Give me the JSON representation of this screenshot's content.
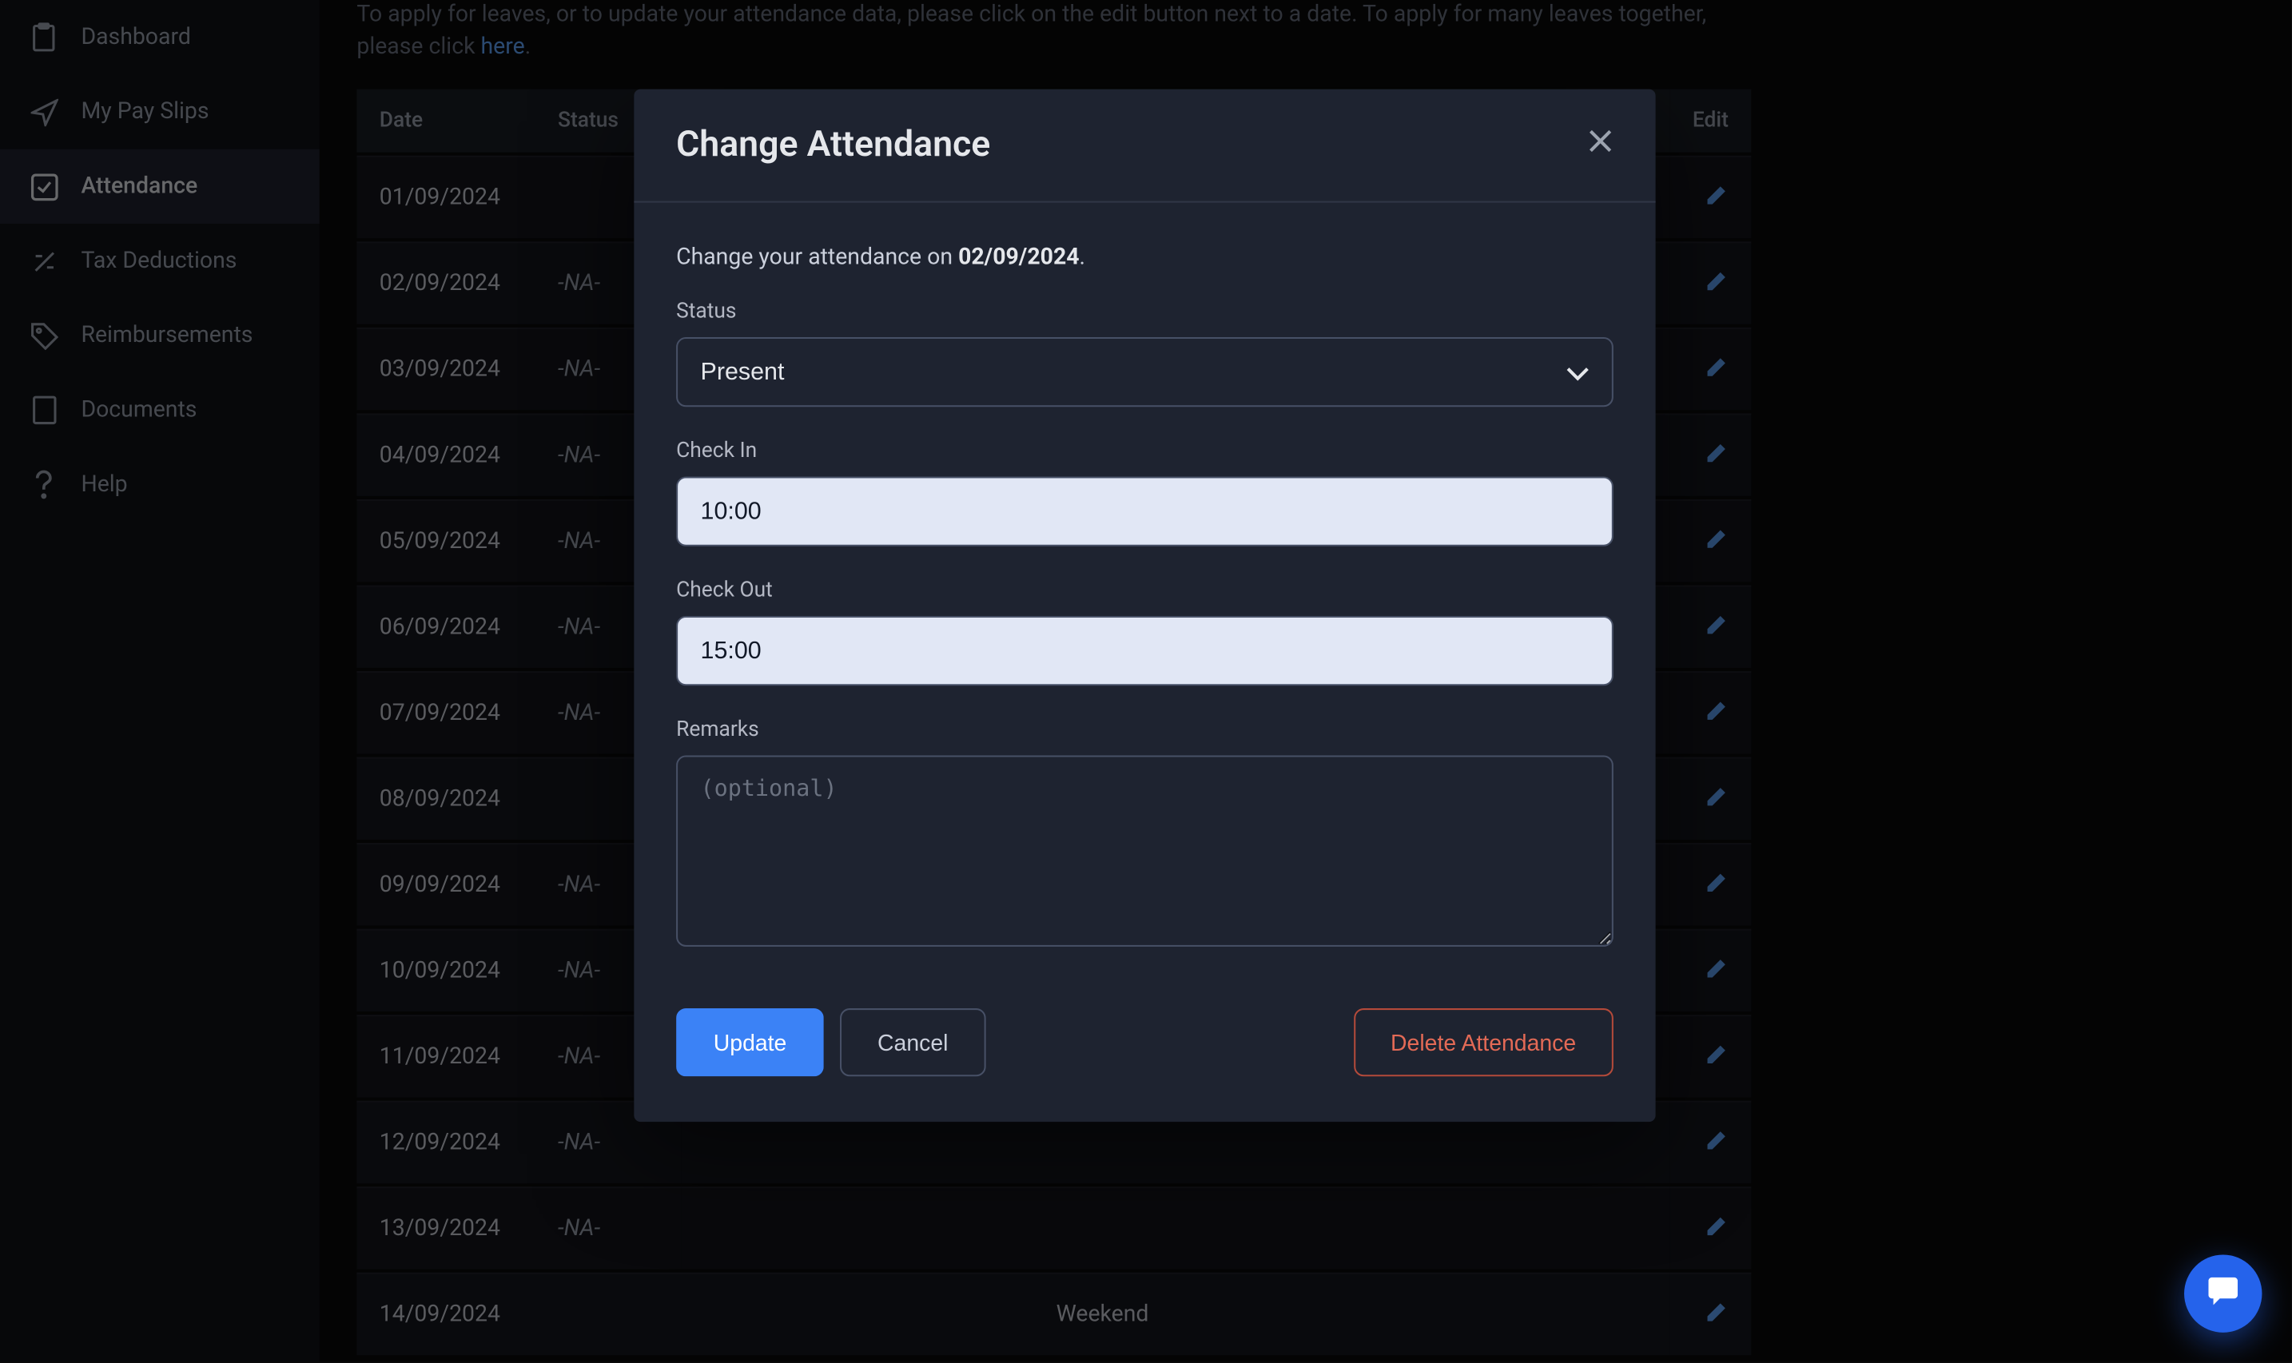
{
  "sidebar": {
    "items": [
      {
        "label": "Dashboard",
        "icon": "clipboard-icon",
        "active": false
      },
      {
        "label": "My Pay Slips",
        "icon": "send-icon",
        "active": false
      },
      {
        "label": "Attendance",
        "icon": "check-square-icon",
        "active": true
      },
      {
        "label": "Tax Deductions",
        "icon": "percent-icon",
        "active": false
      },
      {
        "label": "Reimbursements",
        "icon": "tag-icon",
        "active": false
      },
      {
        "label": "Documents",
        "icon": "document-icon",
        "active": false
      },
      {
        "label": "Help",
        "icon": "question-icon",
        "active": false
      }
    ]
  },
  "intro": {
    "text": "To apply for leaves, or to update your attendance data, please click on the edit button next to a date. To apply for many leaves together, please click ",
    "link_text": "here",
    "suffix": "."
  },
  "table": {
    "headers": {
      "date": "Date",
      "status": "Status",
      "edit": "Edit"
    },
    "rows": [
      {
        "date": "01/09/2024",
        "status": "",
        "weekend": false
      },
      {
        "date": "02/09/2024",
        "status": "-NA-",
        "weekend": false
      },
      {
        "date": "03/09/2024",
        "status": "-NA-",
        "weekend": false
      },
      {
        "date": "04/09/2024",
        "status": "-NA-",
        "weekend": false
      },
      {
        "date": "05/09/2024",
        "status": "-NA-",
        "weekend": false
      },
      {
        "date": "06/09/2024",
        "status": "-NA-",
        "weekend": false
      },
      {
        "date": "07/09/2024",
        "status": "-NA-",
        "weekend": false
      },
      {
        "date": "08/09/2024",
        "status": "",
        "weekend": false
      },
      {
        "date": "09/09/2024",
        "status": "-NA-",
        "weekend": false
      },
      {
        "date": "10/09/2024",
        "status": "-NA-",
        "weekend": false
      },
      {
        "date": "11/09/2024",
        "status": "-NA-",
        "weekend": false
      },
      {
        "date": "12/09/2024",
        "status": "-NA-",
        "weekend": false
      },
      {
        "date": "13/09/2024",
        "status": "-NA-",
        "weekend": false
      },
      {
        "date": "14/09/2024",
        "status": "",
        "weekend": true,
        "weekend_label": "Weekend"
      }
    ]
  },
  "modal": {
    "title": "Change Attendance",
    "desc_prefix": "Change your attendance on ",
    "desc_date": "02/09/2024",
    "desc_suffix": ".",
    "status_label": "Status",
    "status_value": "Present",
    "checkin_label": "Check In",
    "checkin_value": "10:00",
    "checkout_label": "Check Out",
    "checkout_value": "15:00",
    "remarks_label": "Remarks",
    "remarks_placeholder": "(optional)",
    "update_btn": "Update",
    "cancel_btn": "Cancel",
    "delete_btn": "Delete Attendance"
  }
}
